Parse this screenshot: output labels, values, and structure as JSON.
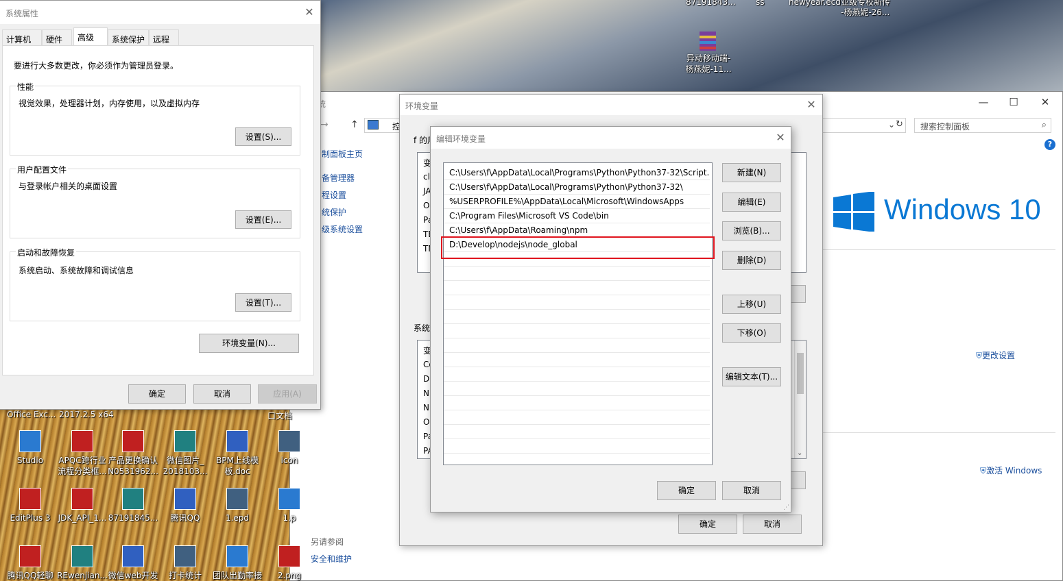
{
  "desktop": {
    "top_labels": [
      "87191843...",
      "ss",
      "newyear.ecd",
      "亚级专校新传",
      "-杨燕妮-26..."
    ],
    "top_right_icon": {
      "label_line1": "异动移动端-",
      "label_line2": "杨燕妮-11..."
    },
    "bottom_rows": [
      [
        {
          "label1": "Studio",
          "label2": ""
        },
        {
          "label1": "APQC跨行业",
          "label2": "流程分类框..."
        },
        {
          "label1": "产品更换确认",
          "label2": "N0531962..."
        },
        {
          "label1": "微信图片_",
          "label2": "2018103..."
        },
        {
          "label1": "BPM上线模",
          "label2": "板.doc"
        },
        {
          "label1": "icon",
          "label2": ""
        }
      ],
      [
        {
          "label1": "EditPlus 3",
          "label2": ""
        },
        {
          "label1": "JDK_API_1...",
          "label2": ""
        },
        {
          "label1": "87191845...",
          "label2": ""
        },
        {
          "label1": "腾讯QQ",
          "label2": ""
        },
        {
          "label1": "1.epd",
          "label2": ""
        },
        {
          "label1": "1.p",
          "label2": ""
        }
      ],
      [
        {
          "label1": "腾讯QQ轻聊",
          "label2": ""
        },
        {
          "label1": "REwenjian...",
          "label2": ""
        },
        {
          "label1": "微信web开发",
          "label2": ""
        },
        {
          "label1": "打卡统计",
          "label2": ""
        },
        {
          "label1": "团队出勤率接",
          "label2": ""
        },
        {
          "label1": "2.png",
          "label2": ""
        }
      ]
    ],
    "strip_left": "Office Exc...",
    "strip_mid": "2017.2.5 x64",
    "strip_right": "口文档"
  },
  "control_panel": {
    "title_partial": "统",
    "address_partial": "控",
    "search_placeholder": "搜索控制面板",
    "nav_links": [
      "制面板主页",
      "备管理器",
      "程设置",
      "统保护",
      "级系统设置"
    ],
    "windows_brand": "Windows 10",
    "change_settings": "更改设置",
    "activate": "激活 Windows",
    "see_also": "另请参阅",
    "security": "安全和维护",
    "help": "?"
  },
  "system_properties": {
    "title": "系统属性",
    "tabs": [
      "计算机名",
      "硬件",
      "高级",
      "系统保护",
      "远程"
    ],
    "admin_note": "要进行大多数更改，你必须作为管理员登录。",
    "performance": {
      "title": "性能",
      "desc": "视觉效果，处理器计划，内存使用，以及虚拟内存",
      "button": "设置(S)..."
    },
    "user_profiles": {
      "title": "用户配置文件",
      "desc": "与登录帐户相关的桌面设置",
      "button": "设置(E)..."
    },
    "startup_recovery": {
      "title": "启动和故障恢复",
      "desc": "系统启动、系统故障和调试信息",
      "button": "设置(T)..."
    },
    "env_button": "环境变量(N)...",
    "ok": "确定",
    "cancel": "取消",
    "apply": "应用(A)"
  },
  "environment_variables": {
    "title": "环境变量",
    "user_section_partial": "f 的用",
    "user_rows_partial": [
      "变",
      "cla",
      "JA",
      "On",
      "Pa",
      "TE",
      "TN"
    ],
    "system_section_partial": "系统",
    "system_rows_partial": [
      "变",
      "Co",
      "Dr",
      "NU",
      "NU",
      "OS",
      "Pa",
      "PA"
    ],
    "ok": "确定",
    "cancel": "取消"
  },
  "edit_env": {
    "title": "编辑环境变量",
    "paths": [
      "C:\\Users\\f\\AppData\\Local\\Programs\\Python\\Python37-32\\Script...",
      "C:\\Users\\f\\AppData\\Local\\Programs\\Python\\Python37-32\\",
      "%USERPROFILE%\\AppData\\Local\\Microsoft\\WindowsApps",
      "C:\\Program Files\\Microsoft VS Code\\bin",
      "C:\\Users\\f\\AppData\\Roaming\\npm",
      "D:\\Develop\\nodejs\\node_global"
    ],
    "buttons": {
      "new": "新建(N)",
      "edit": "编辑(E)",
      "browse": "浏览(B)...",
      "delete": "删除(D)",
      "up": "上移(U)",
      "down": "下移(O)",
      "edit_text": "编辑文本(T)...",
      "ok": "确定",
      "cancel": "取消"
    },
    "highlight_color": "#e0141e"
  }
}
